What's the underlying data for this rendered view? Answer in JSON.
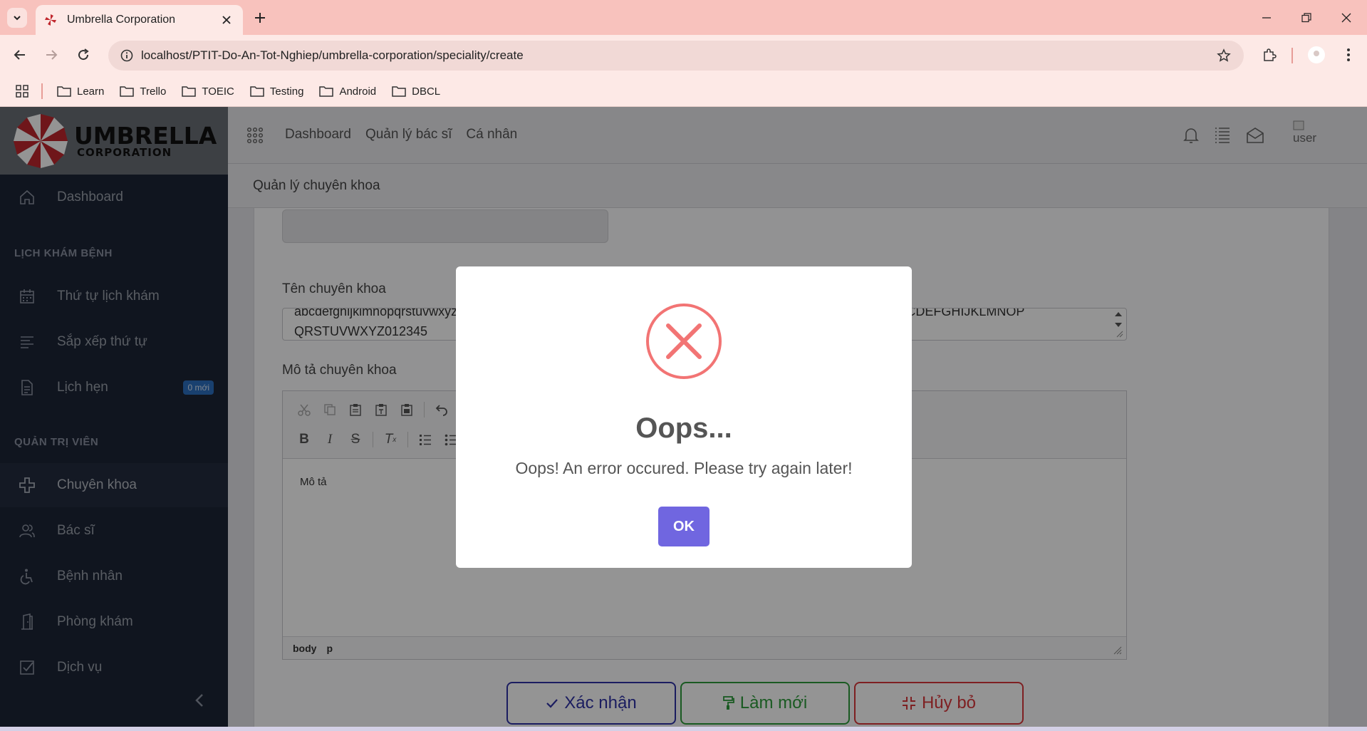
{
  "browser": {
    "tab_title": "Umbrella Corporation",
    "url": "localhost/PTIT-Do-An-Tot-Nghiep/umbrella-corporation/speciality/create",
    "bookmarks": [
      "Learn",
      "Trello",
      "TOEIC",
      "Testing",
      "Android",
      "DBCL"
    ]
  },
  "logo": {
    "line1": "UMBRELLA",
    "line2": "CORPORATION"
  },
  "topnav": {
    "items": [
      "Dashboard",
      "Quản lý bác sĩ",
      "Cá nhân"
    ],
    "avatar_alt": "user"
  },
  "sidebar": {
    "dashboard": "Dashboard",
    "section1": "LỊCH KHÁM BỆNH",
    "schedule_order": "Thứ tự lịch khám",
    "sort_order": "Sắp xếp thứ tự",
    "appointments": "Lịch hẹn",
    "appointments_badge": "0 mới",
    "section2": "QUẢN TRỊ VIÊN",
    "specialties": "Chuyên khoa",
    "doctors": "Bác sĩ",
    "patients": "Bệnh nhân",
    "clinics": "Phòng khám",
    "services": "Dịch vụ"
  },
  "breadcrumb": "Quản lý chuyên khoa",
  "form": {
    "name_label": "Tên chuyên khoa",
    "name_value_line1": "abcdefghijklmnopqrstuvwxyzABCDEFGHIJKLMNOPQRSTUVWXYZ012345abcdefghijklmnopqrstuvwxyzABCDEFGHIJKLMNOP",
    "name_value_line2": "QRSTUVWXYZ012345",
    "desc_label": "Mô tả chuyên khoa",
    "desc_value": "Mô tả",
    "status_body": "body",
    "status_p": "p",
    "confirm": "Xác nhận",
    "reset": "Làm mới",
    "cancel": "Hủy bỏ"
  },
  "dialog": {
    "title": "Oops...",
    "message": "Oops! An error occured. Please try again later!",
    "ok": "OK"
  },
  "colors": {
    "ok_button": "#7066e0",
    "error": "#f27474",
    "sidebar": "#1d2536"
  }
}
